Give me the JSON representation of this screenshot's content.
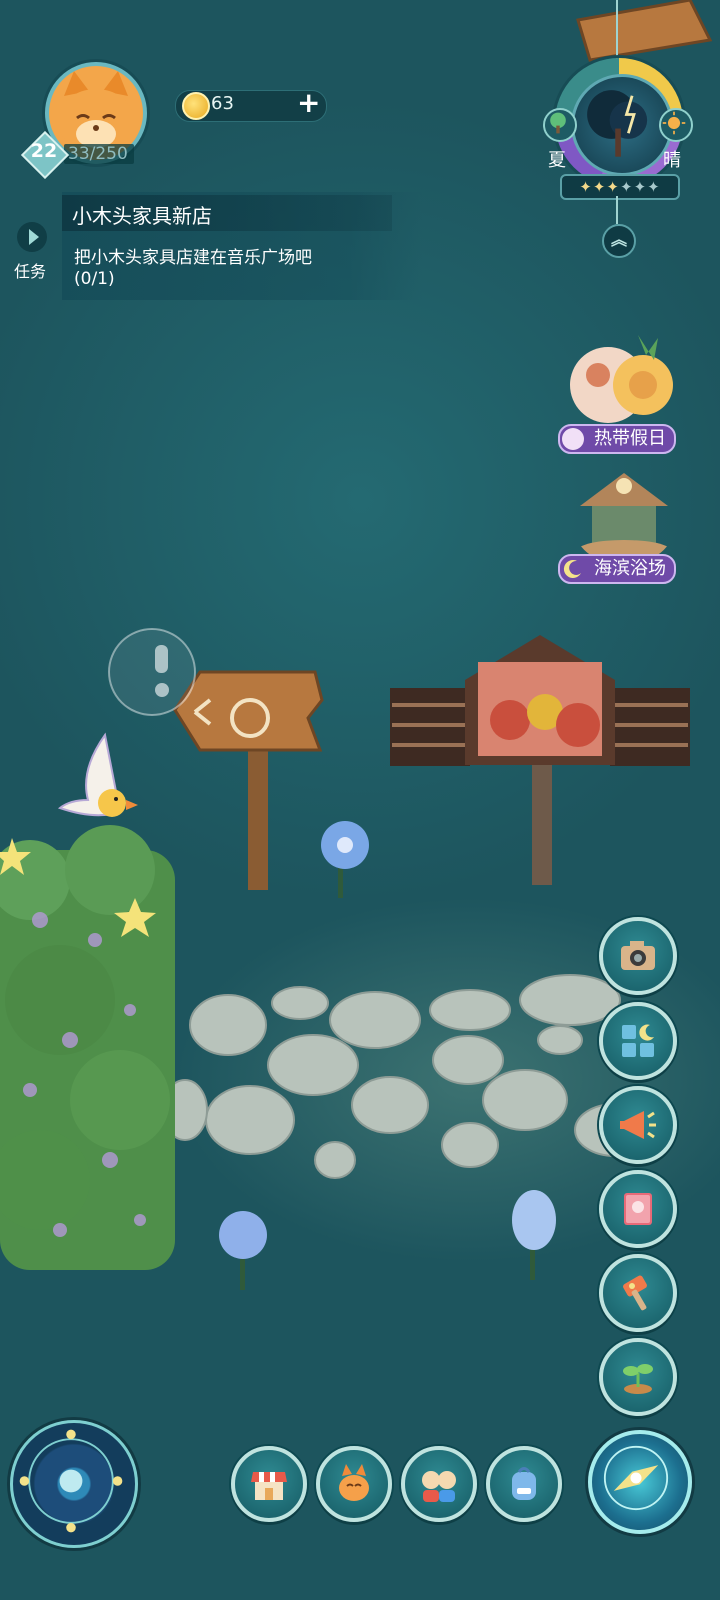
{
  "player": {
    "level": "22",
    "xp": "33/250",
    "coins": "63",
    "coin_add": "+"
  },
  "quest": {
    "tab_label": "任务",
    "title": "小木头家具新店",
    "description": "把小木头家具店建在音乐广场吧",
    "progress": "(0/1)"
  },
  "weather": {
    "season": "夏",
    "condition": "晴",
    "stars_filled": 3,
    "stars_total": 6
  },
  "events": [
    {
      "label": "热带假日",
      "icon": "money-bag-icon"
    },
    {
      "label": "海滨浴场",
      "icon": "moon-icon"
    }
  ],
  "side_buttons": [
    {
      "name": "camera-button",
      "icon": "camera-icon"
    },
    {
      "name": "build-menu-button",
      "icon": "grid-moon-icon"
    },
    {
      "name": "announcement-button",
      "icon": "megaphone-icon"
    },
    {
      "name": "catalog-button",
      "icon": "flower-book-icon"
    },
    {
      "name": "hammer-button",
      "icon": "hammer-icon"
    },
    {
      "name": "plant-button",
      "icon": "sprout-icon"
    }
  ],
  "bottom_buttons": [
    {
      "name": "shop-button",
      "icon": "shop-icon"
    },
    {
      "name": "character-button",
      "icon": "fox-icon"
    },
    {
      "name": "friends-button",
      "icon": "friends-icon"
    },
    {
      "name": "backpack-button",
      "icon": "backpack-icon"
    }
  ],
  "colors": {
    "background": "#1f5a63",
    "panel": "#164e5a",
    "accent_gold": "#f0c94a",
    "event_purple": "#6f4aa8"
  }
}
